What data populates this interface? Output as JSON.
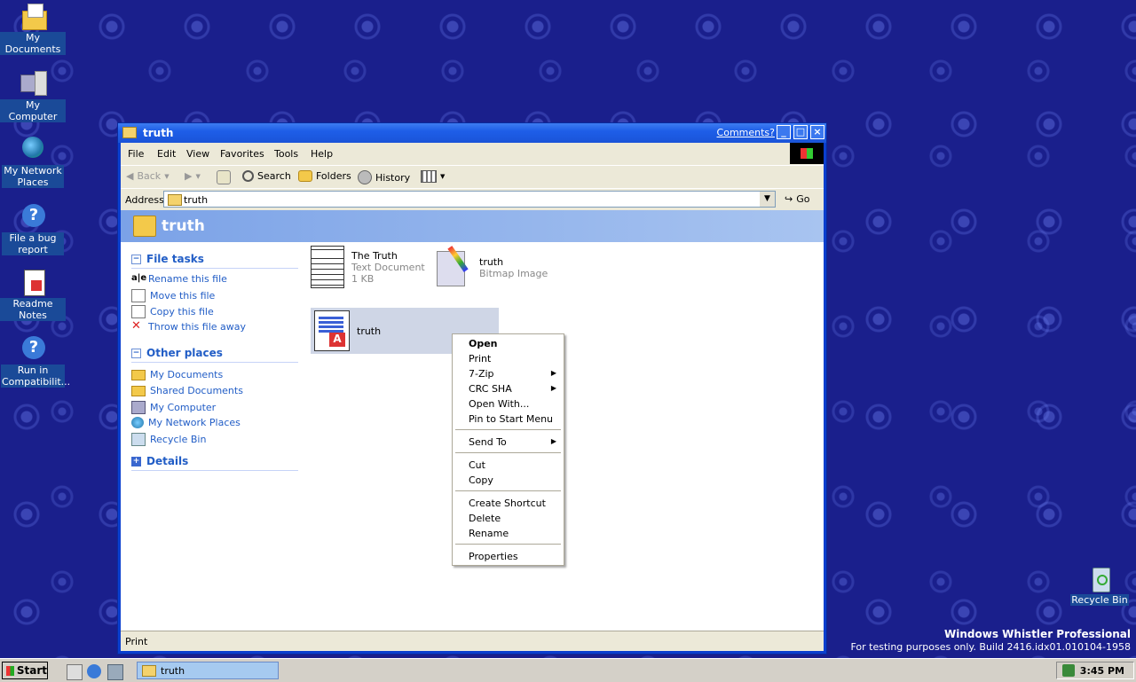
{
  "desktop": {
    "icons": [
      {
        "label": "My Documents",
        "icon": "my-documents-icon"
      },
      {
        "label": "My Computer",
        "icon": "computer-icon"
      },
      {
        "label": "My Network Places",
        "icon": "network-icon"
      },
      {
        "label": "File a bug report",
        "icon": "help-shortcut-icon"
      },
      {
        "label": "Readme Notes",
        "icon": "document-shortcut-icon"
      },
      {
        "label": "Run in Compatibilit...",
        "icon": "help-shortcut-icon"
      }
    ],
    "recycle_bin": "Recycle Bin",
    "watermark": {
      "line1": "Windows Whistler Professional",
      "line2": "For testing purposes only. Build 2416.idx01.010104-1958"
    }
  },
  "window": {
    "title": "truth",
    "comments_link": "Comments?",
    "menu": [
      "File",
      "Edit",
      "View",
      "Favorites",
      "Tools",
      "Help"
    ],
    "toolbar": {
      "back": "Back",
      "search": "Search",
      "folders": "Folders",
      "history": "History"
    },
    "address": {
      "label": "Address",
      "value": "truth",
      "go": "Go"
    },
    "banner_title": "truth",
    "file_tasks": {
      "header": "File tasks",
      "items": [
        "Rename this file",
        "Move this file",
        "Copy this file",
        "Throw this file away"
      ]
    },
    "other_places": {
      "header": "Other places",
      "items": [
        "My Documents",
        "Shared Documents",
        "My Computer",
        "My Network Places",
        "Recycle Bin"
      ]
    },
    "details_header": "Details",
    "files": [
      {
        "name": "The Truth",
        "type": "Text Document",
        "size": "1 KB"
      },
      {
        "name": "truth",
        "type": "Bitmap Image"
      },
      {
        "name": "truth"
      }
    ],
    "status": "Print"
  },
  "context_menu": {
    "items": [
      {
        "label": "Open",
        "bold": true
      },
      {
        "label": "Print"
      },
      {
        "label": "7-Zip",
        "submenu": true
      },
      {
        "label": "CRC SHA",
        "submenu": true
      },
      {
        "label": "Open With..."
      },
      {
        "label": "Pin to Start Menu"
      },
      {
        "label": "Send To",
        "submenu": true
      },
      {
        "label": "Cut"
      },
      {
        "label": "Copy"
      },
      {
        "label": "Create Shortcut"
      },
      {
        "label": "Delete"
      },
      {
        "label": "Rename"
      },
      {
        "label": "Properties"
      }
    ]
  },
  "taskbar": {
    "start": "Start",
    "task": "truth",
    "clock": "3:45 PM"
  },
  "colors": {
    "desktop": "#1a1f8c",
    "titlebar": "#1e5ee8",
    "link": "#215dc6"
  }
}
